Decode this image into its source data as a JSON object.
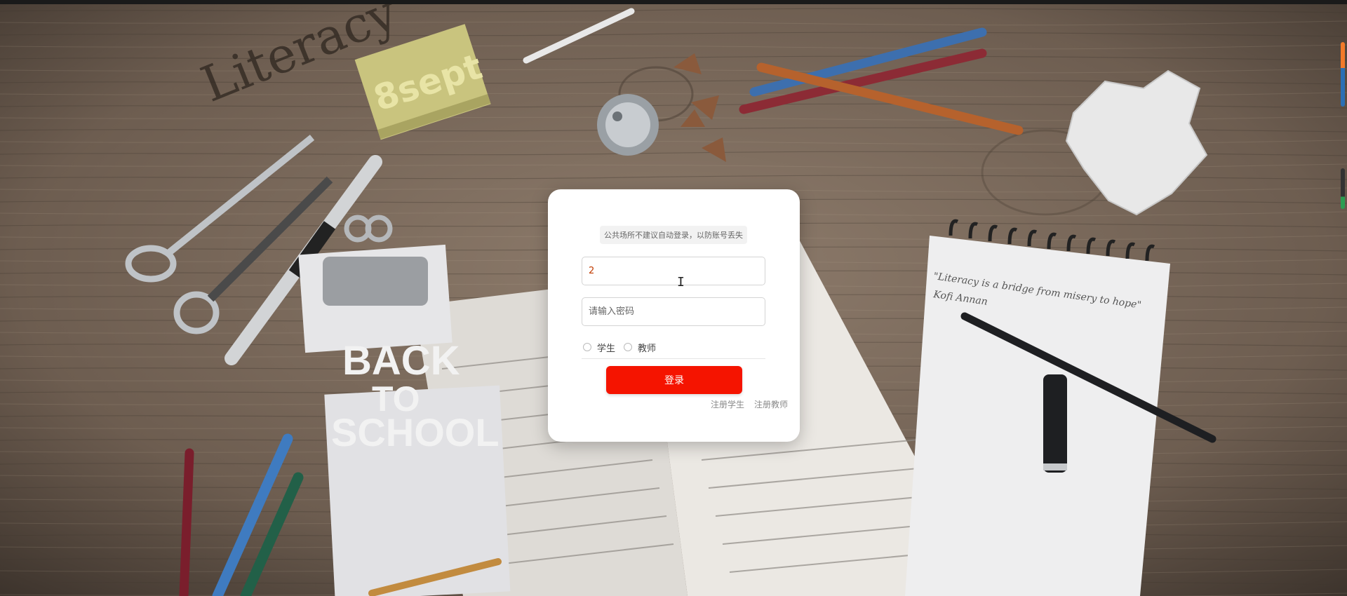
{
  "colors": {
    "accent": "#f51400",
    "wood_light": "#8a7868",
    "wood_dark": "#4e4339",
    "card": "#ffffff"
  },
  "background": {
    "desk_handwriting": "Literacy",
    "sticky_note_text": "8sept",
    "clipboard_text": [
      "BACK",
      "TO",
      "SCHOOL"
    ],
    "notebook_quote_line1": "\"Literacy is a bridge from misery to hope\"",
    "notebook_quote_line2": "Kofi Annan"
  },
  "login": {
    "notice": "公共场所不建议自动登录，以防账号丢失",
    "username_value": "2",
    "password_placeholder": "请输入密码",
    "roles": [
      {
        "label": "学生",
        "selected": false
      },
      {
        "label": "教师",
        "selected": false
      }
    ],
    "submit_label": "登录",
    "links": {
      "register_student": "注册学生",
      "register_teacher": "注册教师"
    }
  },
  "icons": {
    "text_cursor": "I-beam-cursor-icon"
  }
}
